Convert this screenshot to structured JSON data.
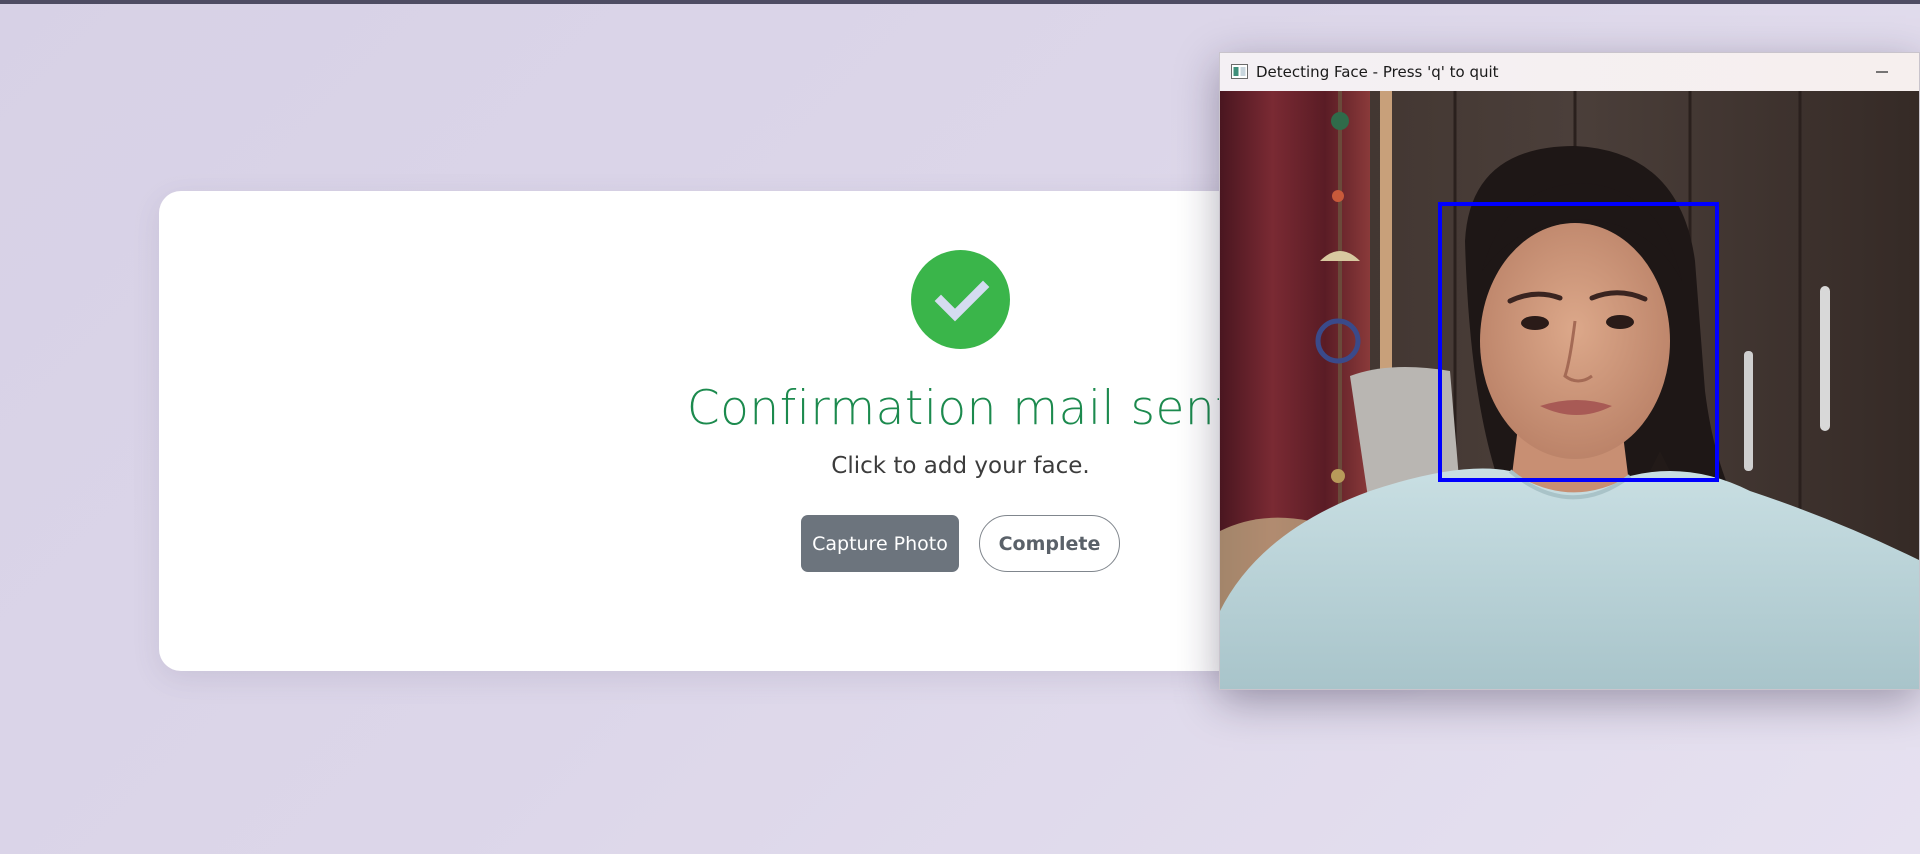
{
  "confirmation": {
    "title": "Confirmation mail sent",
    "subtitle": "Click to add your face.",
    "capture_label": "Capture Photo",
    "complete_label": "Complete",
    "success_color": "#3ab54a",
    "title_color": "#1c8a4e"
  },
  "camera_window": {
    "title": "Detecting Face - Press 'q' to quit",
    "detection_box_color": "#0000ff",
    "icons": [
      "app-icon",
      "minimize-icon"
    ]
  }
}
